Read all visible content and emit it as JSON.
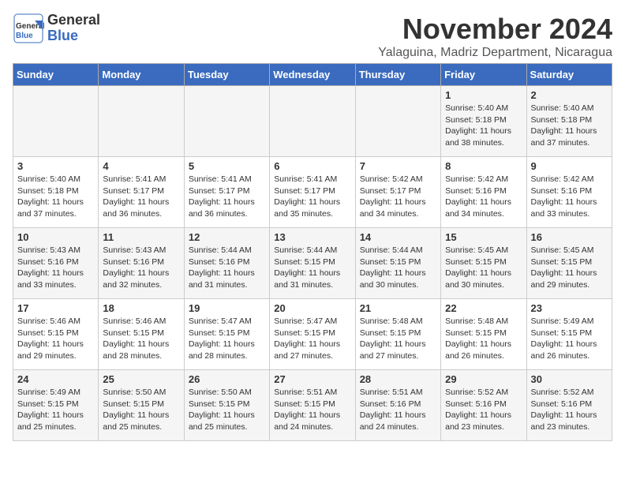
{
  "header": {
    "logo_line1": "General",
    "logo_line2": "Blue",
    "month": "November 2024",
    "location": "Yalaguina, Madriz Department, Nicaragua"
  },
  "weekdays": [
    "Sunday",
    "Monday",
    "Tuesday",
    "Wednesday",
    "Thursday",
    "Friday",
    "Saturday"
  ],
  "weeks": [
    [
      {
        "day": "",
        "info": ""
      },
      {
        "day": "",
        "info": ""
      },
      {
        "day": "",
        "info": ""
      },
      {
        "day": "",
        "info": ""
      },
      {
        "day": "",
        "info": ""
      },
      {
        "day": "1",
        "info": "Sunrise: 5:40 AM\nSunset: 5:18 PM\nDaylight: 11 hours and 38 minutes."
      },
      {
        "day": "2",
        "info": "Sunrise: 5:40 AM\nSunset: 5:18 PM\nDaylight: 11 hours and 37 minutes."
      }
    ],
    [
      {
        "day": "3",
        "info": "Sunrise: 5:40 AM\nSunset: 5:18 PM\nDaylight: 11 hours and 37 minutes."
      },
      {
        "day": "4",
        "info": "Sunrise: 5:41 AM\nSunset: 5:17 PM\nDaylight: 11 hours and 36 minutes."
      },
      {
        "day": "5",
        "info": "Sunrise: 5:41 AM\nSunset: 5:17 PM\nDaylight: 11 hours and 36 minutes."
      },
      {
        "day": "6",
        "info": "Sunrise: 5:41 AM\nSunset: 5:17 PM\nDaylight: 11 hours and 35 minutes."
      },
      {
        "day": "7",
        "info": "Sunrise: 5:42 AM\nSunset: 5:17 PM\nDaylight: 11 hours and 34 minutes."
      },
      {
        "day": "8",
        "info": "Sunrise: 5:42 AM\nSunset: 5:16 PM\nDaylight: 11 hours and 34 minutes."
      },
      {
        "day": "9",
        "info": "Sunrise: 5:42 AM\nSunset: 5:16 PM\nDaylight: 11 hours and 33 minutes."
      }
    ],
    [
      {
        "day": "10",
        "info": "Sunrise: 5:43 AM\nSunset: 5:16 PM\nDaylight: 11 hours and 33 minutes."
      },
      {
        "day": "11",
        "info": "Sunrise: 5:43 AM\nSunset: 5:16 PM\nDaylight: 11 hours and 32 minutes."
      },
      {
        "day": "12",
        "info": "Sunrise: 5:44 AM\nSunset: 5:16 PM\nDaylight: 11 hours and 31 minutes."
      },
      {
        "day": "13",
        "info": "Sunrise: 5:44 AM\nSunset: 5:15 PM\nDaylight: 11 hours and 31 minutes."
      },
      {
        "day": "14",
        "info": "Sunrise: 5:44 AM\nSunset: 5:15 PM\nDaylight: 11 hours and 30 minutes."
      },
      {
        "day": "15",
        "info": "Sunrise: 5:45 AM\nSunset: 5:15 PM\nDaylight: 11 hours and 30 minutes."
      },
      {
        "day": "16",
        "info": "Sunrise: 5:45 AM\nSunset: 5:15 PM\nDaylight: 11 hours and 29 minutes."
      }
    ],
    [
      {
        "day": "17",
        "info": "Sunrise: 5:46 AM\nSunset: 5:15 PM\nDaylight: 11 hours and 29 minutes."
      },
      {
        "day": "18",
        "info": "Sunrise: 5:46 AM\nSunset: 5:15 PM\nDaylight: 11 hours and 28 minutes."
      },
      {
        "day": "19",
        "info": "Sunrise: 5:47 AM\nSunset: 5:15 PM\nDaylight: 11 hours and 28 minutes."
      },
      {
        "day": "20",
        "info": "Sunrise: 5:47 AM\nSunset: 5:15 PM\nDaylight: 11 hours and 27 minutes."
      },
      {
        "day": "21",
        "info": "Sunrise: 5:48 AM\nSunset: 5:15 PM\nDaylight: 11 hours and 27 minutes."
      },
      {
        "day": "22",
        "info": "Sunrise: 5:48 AM\nSunset: 5:15 PM\nDaylight: 11 hours and 26 minutes."
      },
      {
        "day": "23",
        "info": "Sunrise: 5:49 AM\nSunset: 5:15 PM\nDaylight: 11 hours and 26 minutes."
      }
    ],
    [
      {
        "day": "24",
        "info": "Sunrise: 5:49 AM\nSunset: 5:15 PM\nDaylight: 11 hours and 25 minutes."
      },
      {
        "day": "25",
        "info": "Sunrise: 5:50 AM\nSunset: 5:15 PM\nDaylight: 11 hours and 25 minutes."
      },
      {
        "day": "26",
        "info": "Sunrise: 5:50 AM\nSunset: 5:15 PM\nDaylight: 11 hours and 25 minutes."
      },
      {
        "day": "27",
        "info": "Sunrise: 5:51 AM\nSunset: 5:15 PM\nDaylight: 11 hours and 24 minutes."
      },
      {
        "day": "28",
        "info": "Sunrise: 5:51 AM\nSunset: 5:16 PM\nDaylight: 11 hours and 24 minutes."
      },
      {
        "day": "29",
        "info": "Sunrise: 5:52 AM\nSunset: 5:16 PM\nDaylight: 11 hours and 23 minutes."
      },
      {
        "day": "30",
        "info": "Sunrise: 5:52 AM\nSunset: 5:16 PM\nDaylight: 11 hours and 23 minutes."
      }
    ]
  ]
}
